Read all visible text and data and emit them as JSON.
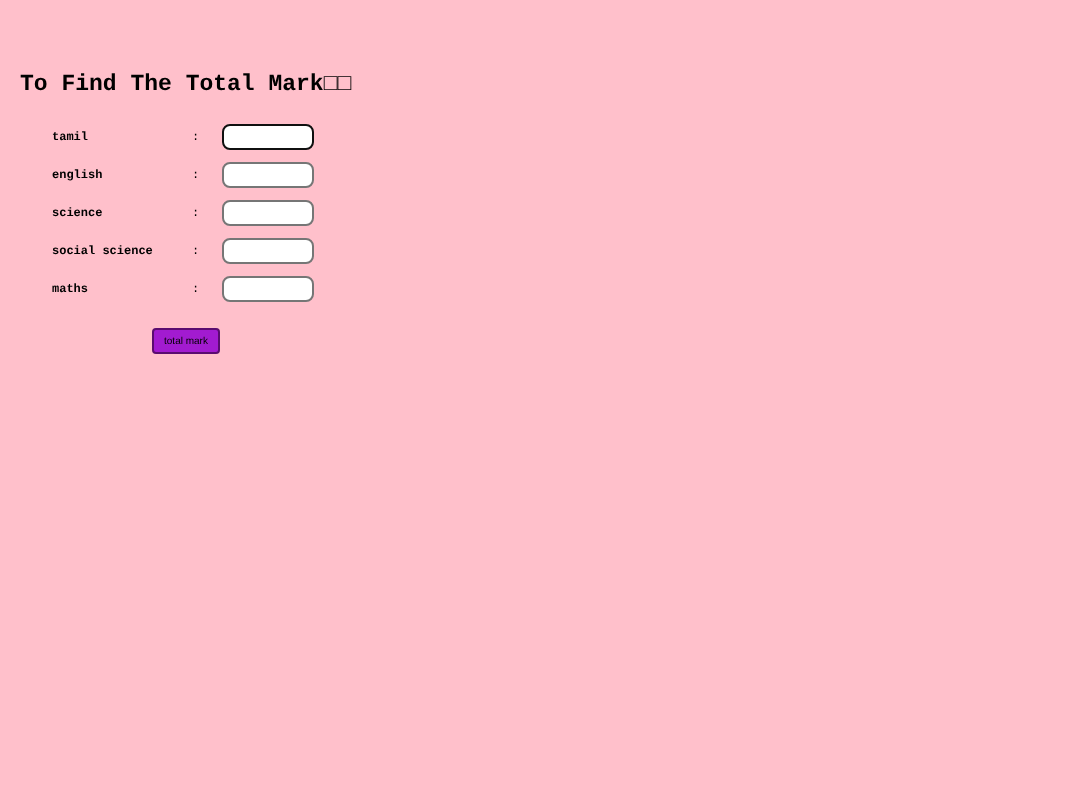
{
  "title": "To Find The Total Mark□□",
  "fields": [
    {
      "label": "tamil",
      "separator": ":",
      "focused": true
    },
    {
      "label": "english",
      "separator": ":",
      "focused": false
    },
    {
      "label": "science",
      "separator": ":",
      "focused": false
    },
    {
      "label": "social science",
      "separator": ":",
      "focused": false
    },
    {
      "label": "maths",
      "separator": ":",
      "focused": false
    }
  ],
  "button": "total mark"
}
